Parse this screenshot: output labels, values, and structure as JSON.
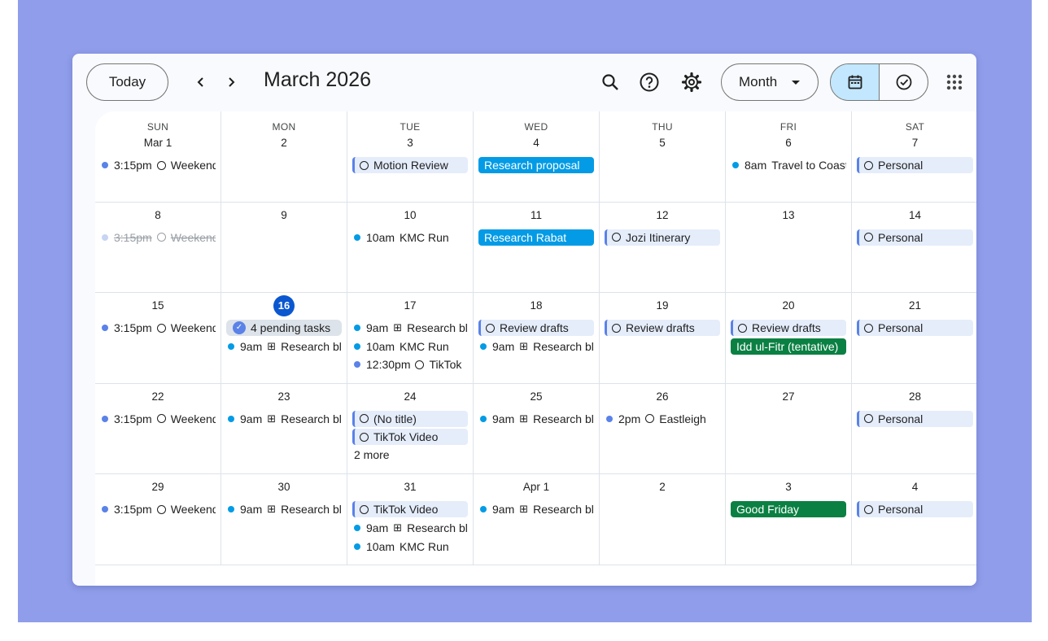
{
  "toolbar": {
    "today_label": "Today",
    "month_title": "March 2026",
    "view_label": "Month",
    "prev_icon": "chevron-left-icon",
    "next_icon": "chevron-right-icon",
    "search_icon": "search-icon",
    "help_icon": "help-icon",
    "settings_icon": "gear-icon",
    "calendar_icon": "calendar-icon",
    "tasks_icon": "tasks-check-icon",
    "apps_icon": "apps-grid-icon"
  },
  "colors": {
    "backdrop": "#8f9dea",
    "today": "#0b57d0",
    "event_blue": "#039be5",
    "event_green": "#0b8043",
    "task_bg": "#e5edfb",
    "toggle_active": "#c2e7ff"
  },
  "weekdays": [
    "SUN",
    "MON",
    "TUE",
    "WED",
    "THU",
    "FRI",
    "SAT"
  ],
  "weeks": [
    [
      {
        "day": "Mar 1",
        "events": [
          {
            "kind": "timed",
            "time": "3:15pm",
            "title": "Weekend",
            "icon": "task"
          }
        ]
      },
      {
        "day": "2",
        "events": []
      },
      {
        "day": "3",
        "events": [
          {
            "kind": "task",
            "title": "Motion Review"
          }
        ]
      },
      {
        "day": "4",
        "events": [
          {
            "kind": "allday",
            "color": "blue",
            "title": "Research proposal"
          }
        ]
      },
      {
        "day": "5",
        "events": []
      },
      {
        "day": "6",
        "events": [
          {
            "kind": "timed",
            "dot": "cyan",
            "time": "8am",
            "title": "Travel to Coast"
          }
        ]
      },
      {
        "day": "7",
        "events": [
          {
            "kind": "task",
            "title": "Personal"
          }
        ]
      }
    ],
    [
      {
        "day": "8",
        "events": [
          {
            "kind": "done",
            "time": "3:15pm",
            "title": "Weekend"
          }
        ]
      },
      {
        "day": "9",
        "events": []
      },
      {
        "day": "10",
        "events": [
          {
            "kind": "timed",
            "dot": "cyan",
            "time": "10am",
            "title": "KMC Run"
          }
        ]
      },
      {
        "day": "11",
        "events": [
          {
            "kind": "allday",
            "color": "blue",
            "title": "Research Rabat"
          }
        ]
      },
      {
        "day": "12",
        "events": [
          {
            "kind": "task",
            "title": "Jozi Itinerary"
          }
        ]
      },
      {
        "day": "13",
        "events": []
      },
      {
        "day": "14",
        "events": [
          {
            "kind": "task",
            "title": "Personal"
          }
        ]
      }
    ],
    [
      {
        "day": "15",
        "events": [
          {
            "kind": "timed",
            "time": "3:15pm",
            "title": "Weekend",
            "icon": "task"
          }
        ]
      },
      {
        "day": "16",
        "today": true,
        "events": [
          {
            "kind": "pending",
            "title": "4 pending tasks"
          },
          {
            "kind": "timed",
            "dot": "cyan",
            "time": "9am",
            "title": "Research block",
            "icon": "grid"
          }
        ]
      },
      {
        "day": "17",
        "events": [
          {
            "kind": "timed",
            "dot": "cyan",
            "time": "9am",
            "title": "Research block",
            "icon": "grid"
          },
          {
            "kind": "timed",
            "dot": "cyan",
            "time": "10am",
            "title": "KMC Run"
          },
          {
            "kind": "timed",
            "time": "12:30pm",
            "title": "TikTok",
            "icon": "task"
          }
        ]
      },
      {
        "day": "18",
        "events": [
          {
            "kind": "task",
            "title": "Review drafts"
          },
          {
            "kind": "timed",
            "dot": "cyan",
            "time": "9am",
            "title": "Research block",
            "icon": "grid"
          }
        ]
      },
      {
        "day": "19",
        "events": [
          {
            "kind": "task",
            "title": "Review drafts"
          }
        ]
      },
      {
        "day": "20",
        "events": [
          {
            "kind": "task",
            "title": "Review drafts"
          },
          {
            "kind": "allday",
            "color": "green",
            "title": "Idd ul-Fitr (tentative)"
          }
        ]
      },
      {
        "day": "21",
        "events": [
          {
            "kind": "task",
            "title": "Personal"
          }
        ]
      }
    ],
    [
      {
        "day": "22",
        "events": [
          {
            "kind": "timed",
            "time": "3:15pm",
            "title": "Weekend",
            "icon": "task"
          }
        ]
      },
      {
        "day": "23",
        "events": [
          {
            "kind": "timed",
            "dot": "cyan",
            "time": "9am",
            "title": "Research block",
            "icon": "grid"
          }
        ]
      },
      {
        "day": "24",
        "events": [
          {
            "kind": "task",
            "title": "(No title)"
          },
          {
            "kind": "task",
            "title": "TikTok Video"
          }
        ],
        "more": "2 more"
      },
      {
        "day": "25",
        "events": [
          {
            "kind": "timed",
            "dot": "cyan",
            "time": "9am",
            "title": "Research block",
            "icon": "grid"
          }
        ]
      },
      {
        "day": "26",
        "events": [
          {
            "kind": "timed",
            "time": "2pm",
            "title": "Eastleigh",
            "icon": "task"
          }
        ]
      },
      {
        "day": "27",
        "events": []
      },
      {
        "day": "28",
        "events": [
          {
            "kind": "task",
            "title": "Personal"
          }
        ]
      }
    ],
    [
      {
        "day": "29",
        "events": [
          {
            "kind": "timed",
            "time": "3:15pm",
            "title": "Weekend",
            "icon": "task"
          }
        ]
      },
      {
        "day": "30",
        "events": [
          {
            "kind": "timed",
            "dot": "cyan",
            "time": "9am",
            "title": "Research block",
            "icon": "grid"
          }
        ]
      },
      {
        "day": "31",
        "events": [
          {
            "kind": "task",
            "title": "TikTok Video"
          },
          {
            "kind": "timed",
            "dot": "cyan",
            "time": "9am",
            "title": "Research block",
            "icon": "grid"
          },
          {
            "kind": "timed",
            "dot": "cyan",
            "time": "10am",
            "title": "KMC Run"
          }
        ]
      },
      {
        "day": "Apr 1",
        "events": [
          {
            "kind": "timed",
            "dot": "cyan",
            "time": "9am",
            "title": "Research block",
            "icon": "grid"
          }
        ]
      },
      {
        "day": "2",
        "events": []
      },
      {
        "day": "3",
        "events": [
          {
            "kind": "allday",
            "color": "green",
            "title": "Good Friday"
          }
        ]
      },
      {
        "day": "4",
        "events": [
          {
            "kind": "task",
            "title": "Personal"
          }
        ]
      }
    ]
  ]
}
